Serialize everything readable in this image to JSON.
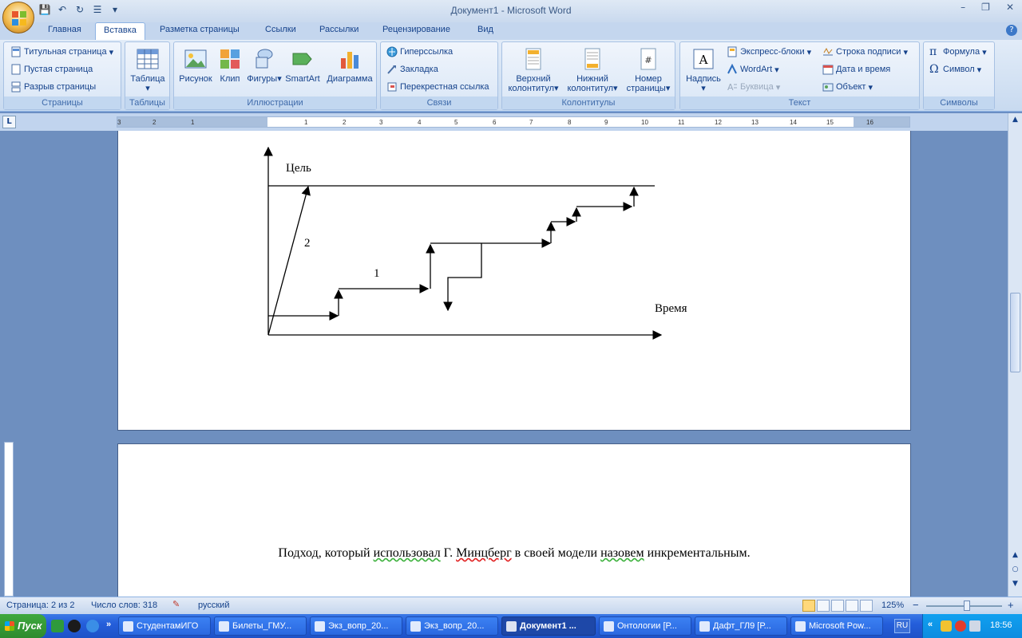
{
  "window": {
    "title": "Документ1 - Microsoft Word",
    "minimize": "–",
    "restore": "❐",
    "close": "✕"
  },
  "qat": {
    "save": "💾",
    "undo": "↶",
    "redo": "↻",
    "list": "☰",
    "more": "▾"
  },
  "tabs": [
    "Главная",
    "Вставка",
    "Разметка страницы",
    "Ссылки",
    "Рассылки",
    "Рецензирование",
    "Вид"
  ],
  "active_tab": "Вставка",
  "ribbon": {
    "pages": {
      "label": "Страницы",
      "items": [
        "Титульная страница",
        "Пустая страница",
        "Разрыв страницы"
      ]
    },
    "tables": {
      "label": "Таблицы",
      "items": [
        "Таблица"
      ]
    },
    "illustrations": {
      "label": "Иллюстрации",
      "items": [
        "Рисунок",
        "Клип",
        "Фигуры",
        "SmartArt",
        "Диаграмма"
      ]
    },
    "links": {
      "label": "Связи",
      "items": [
        "Гиперссылка",
        "Закладка",
        "Перекрестная ссылка"
      ]
    },
    "header_footer": {
      "label": "Колонтитулы",
      "items": [
        {
          "line1": "Верхний",
          "line2": "колонтитул"
        },
        {
          "line1": "Нижний",
          "line2": "колонтитул"
        },
        {
          "line1": "Номер",
          "line2": "страницы"
        }
      ]
    },
    "text": {
      "label": "Текст",
      "big": "Надпись",
      "items": [
        "Экспресс-блоки",
        "WordArt",
        "Буквица",
        "Строка подписи",
        "Дата и время",
        "Объект"
      ]
    },
    "symbols": {
      "label": "Символы",
      "items": [
        "Формула",
        "Символ"
      ]
    }
  },
  "ruler": {
    "corner": "L",
    "ticks": [
      "3",
      "2",
      "1",
      "1",
      "2",
      "3",
      "4",
      "5",
      "6",
      "7",
      "8",
      "9",
      "10",
      "11",
      "12",
      "13",
      "14",
      "15",
      "16",
      "17"
    ]
  },
  "diagram": {
    "goal_label": "Цель",
    "time_label": "Время",
    "path1_label": "1",
    "path2_label": "2"
  },
  "body_text": {
    "part1": "Подход, который ",
    "part2": "использовал",
    "part3": " Г. ",
    "part4": "Минцберг",
    "part5": " в своей модели ",
    "part6": "назовем",
    "part7": " инкрементальным."
  },
  "status": {
    "page": "Страница: 2 из 2",
    "words": "Число слов: 318",
    "lang": "русский",
    "zoom": "125%",
    "zoom_minus": "−",
    "zoom_plus": "+"
  },
  "taskbar": {
    "start": "Пуск",
    "chevron": "»",
    "items": [
      "СтудентамИГО",
      "Билеты_ГМУ...",
      "Экз_вопр_20...",
      "Экз_вопр_20...",
      "Документ1 ...",
      "Онтологии [Р...",
      "Дафт_ГЛ9 [Р...",
      "Microsoft Pow..."
    ],
    "active_item": "Документ1 ...",
    "lang": "RU",
    "tray_chevron": "«",
    "clock": "18:56"
  }
}
